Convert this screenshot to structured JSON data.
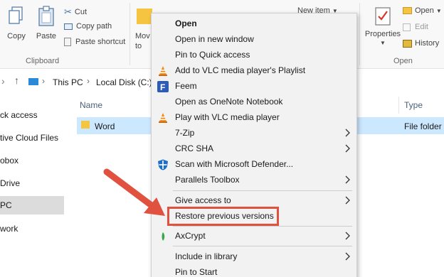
{
  "ribbon": {
    "clipboard": {
      "copy": "Copy",
      "paste": "Paste",
      "cut": "Cut",
      "copy_path": "Copy path",
      "paste_shortcut": "Paste shortcut",
      "group_label": "Clipboard"
    },
    "organize": {
      "move_to": "Mov",
      "move_to_line2": "to"
    },
    "new": {
      "new_item": "New item"
    },
    "open_group": {
      "properties": "Properties",
      "open": "Open",
      "edit": "Edit",
      "history": "History",
      "group_label": "Open"
    }
  },
  "address": {
    "crumbs": [
      "This PC",
      "Local Disk (C:)"
    ]
  },
  "nav": {
    "items": [
      "ck access",
      "tive Cloud Files",
      "obox",
      "Drive",
      "PC",
      "work"
    ],
    "selected_index": 4
  },
  "file_list": {
    "columns": [
      "Name",
      "Type"
    ],
    "rows": [
      {
        "name": "Word",
        "type": "File folder"
      }
    ]
  },
  "context_menu": {
    "items": [
      {
        "label": "Open",
        "bold": true,
        "icon": "",
        "submenu": false
      },
      {
        "label": "Open in new window",
        "icon": "",
        "submenu": false
      },
      {
        "label": "Pin to Quick access",
        "icon": "",
        "submenu": false
      },
      {
        "label": "Add to VLC media player's Playlist",
        "icon": "vlc-cone-icon",
        "submenu": false
      },
      {
        "label": "Feem",
        "icon": "feem-icon",
        "submenu": false
      },
      {
        "label": "Open as OneNote Notebook",
        "icon": "",
        "submenu": false
      },
      {
        "label": "Play with VLC media player",
        "icon": "vlc-cone-icon",
        "submenu": false
      },
      {
        "label": "7-Zip",
        "icon": "",
        "submenu": true
      },
      {
        "label": "CRC SHA",
        "icon": "",
        "submenu": true
      },
      {
        "label": "Scan with Microsoft Defender...",
        "icon": "defender-shield-icon",
        "submenu": false
      },
      {
        "label": "Parallels Toolbox",
        "icon": "",
        "submenu": true
      },
      {
        "label": "Give access to",
        "icon": "",
        "submenu": true
      },
      {
        "label": "Restore previous versions",
        "icon": "",
        "submenu": false
      },
      {
        "label": "AxCrypt",
        "icon": "axcrypt-icon",
        "submenu": true
      },
      {
        "label": "Include in library",
        "icon": "",
        "submenu": true
      },
      {
        "label": "Pin to Start",
        "icon": "",
        "submenu": false
      }
    ],
    "highlighted_item": "Restore previous versions"
  },
  "annotation": {
    "arrow_color": "#e0513f",
    "box_color": "#e0513f"
  }
}
